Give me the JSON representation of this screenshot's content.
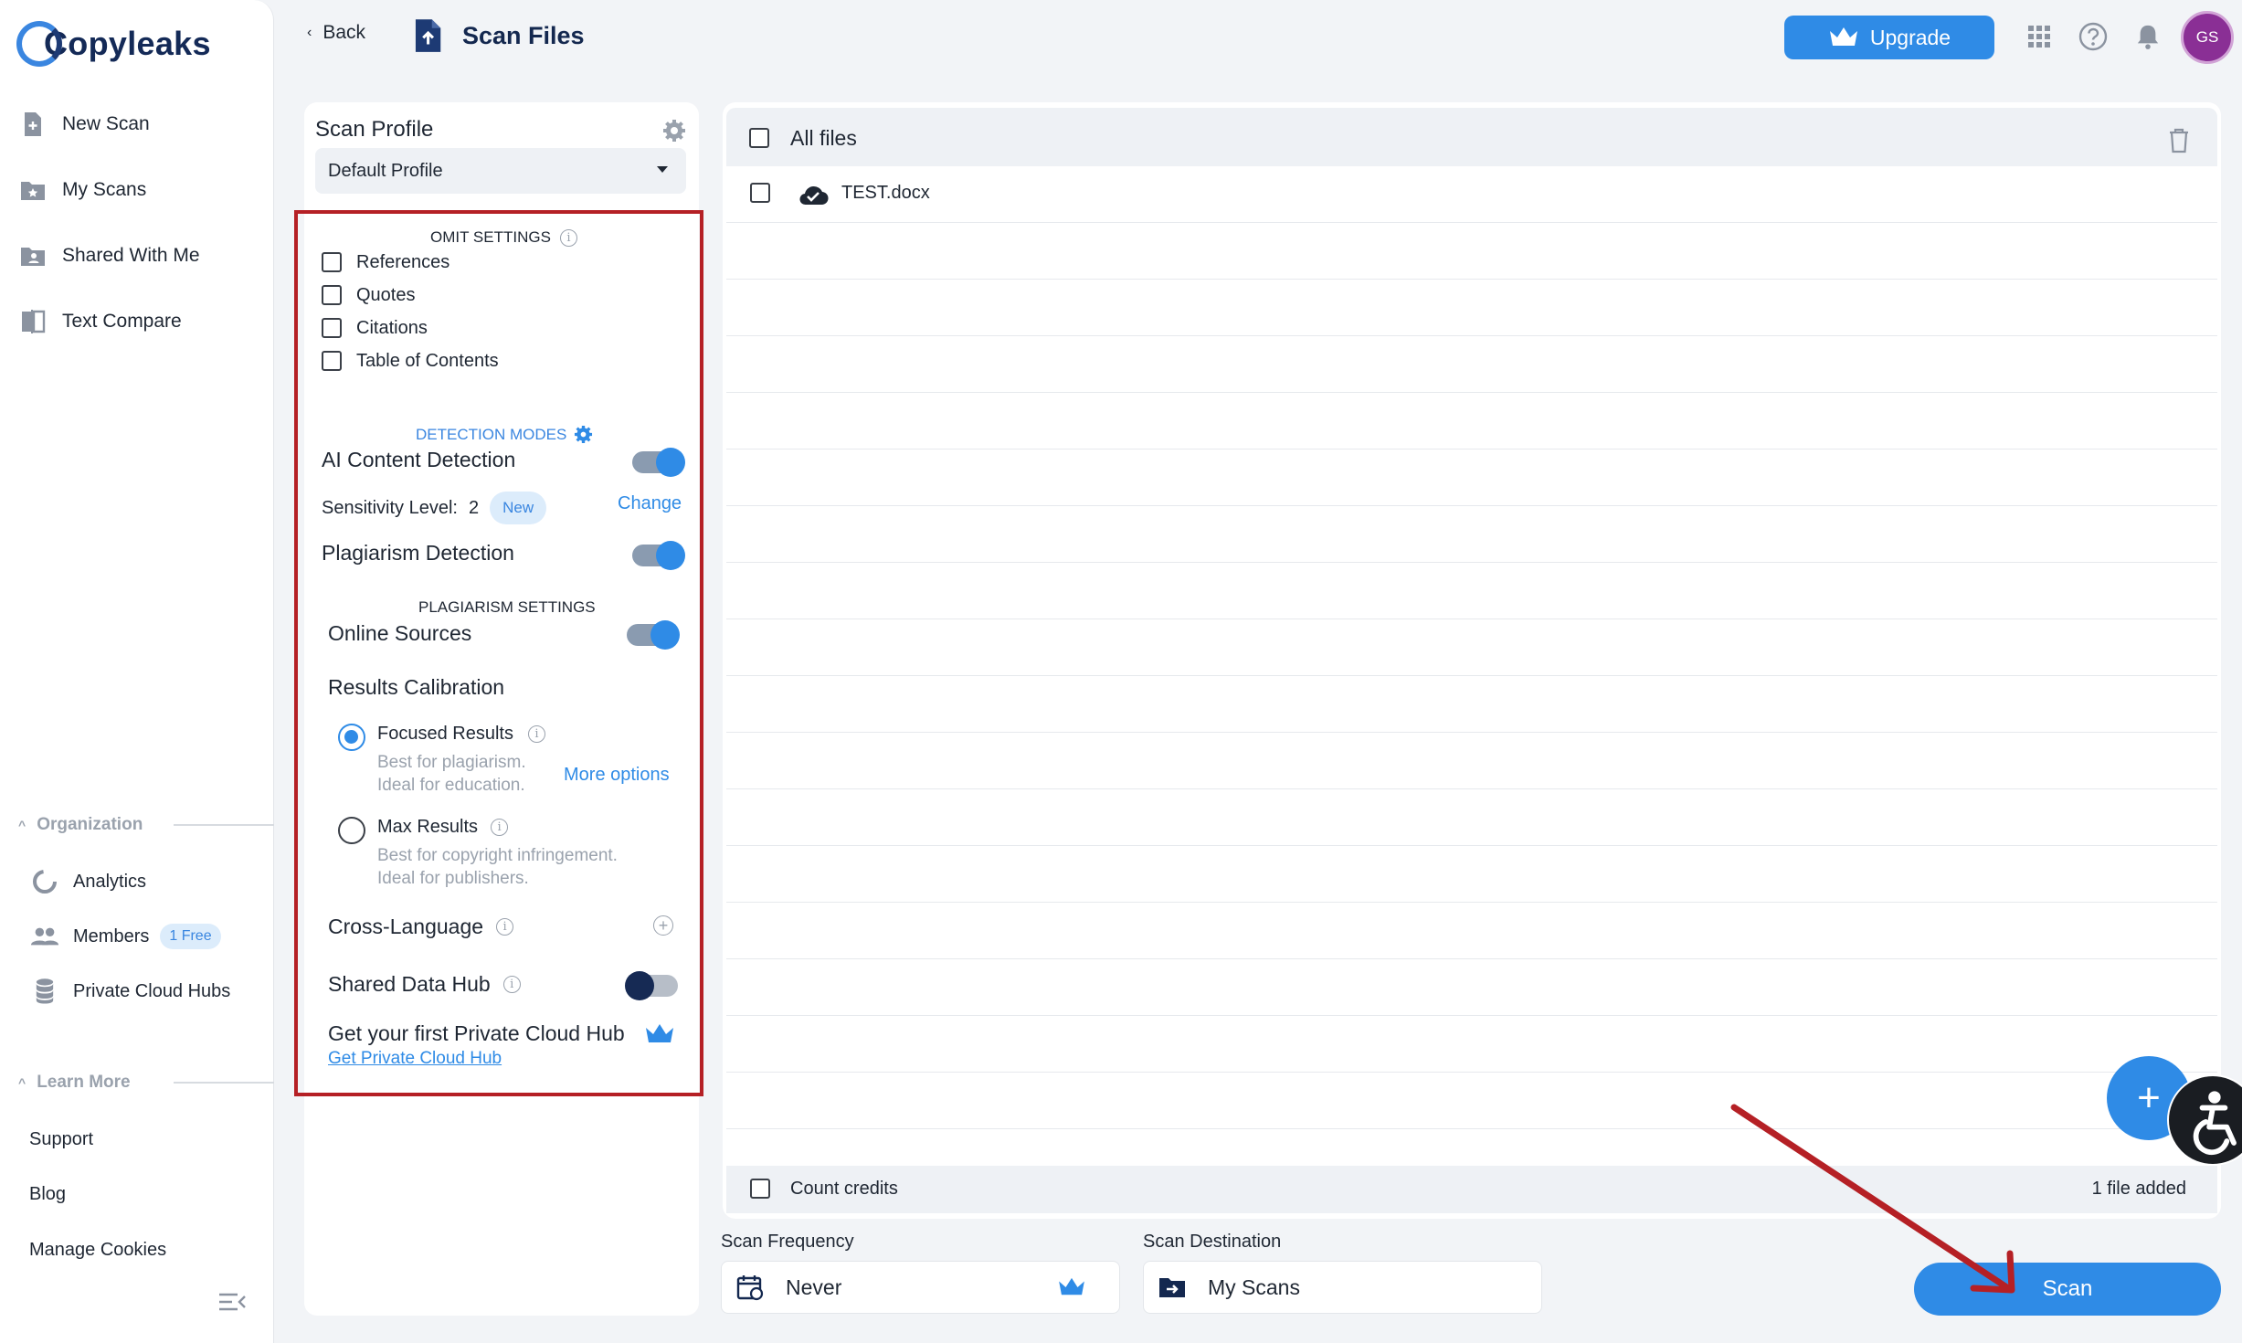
{
  "brand": {
    "name": "Copyleaks"
  },
  "sidebar": {
    "nav": [
      {
        "label": "New Scan",
        "icon": "new-scan-icon"
      },
      {
        "label": "My Scans",
        "icon": "my-scans-icon"
      },
      {
        "label": "Shared With Me",
        "icon": "shared-folder-icon"
      },
      {
        "label": "Text Compare",
        "icon": "text-compare-icon"
      }
    ],
    "organization": {
      "title": "Organization",
      "items": [
        {
          "label": "Analytics",
          "icon": "analytics-icon"
        },
        {
          "label": "Members",
          "icon": "members-icon",
          "badge": "1 Free"
        },
        {
          "label": "Private Cloud Hubs",
          "icon": "database-icon"
        }
      ]
    },
    "learn_more": {
      "title": "Learn More",
      "items": [
        {
          "label": "Support"
        },
        {
          "label": "Blog"
        },
        {
          "label": "Manage Cookies"
        }
      ]
    }
  },
  "header": {
    "back_label": "Back",
    "title": "Scan Files",
    "upgrade_label": "Upgrade",
    "avatar_initials": "GS"
  },
  "profile": {
    "title": "Scan Profile",
    "selected": "Default Profile",
    "omit_settings": {
      "title": "OMIT SETTINGS",
      "options": [
        "References",
        "Quotes",
        "Citations",
        "Table of Contents"
      ]
    },
    "detection_modes": {
      "title": "DETECTION MODES",
      "ai_label": "AI Content Detection",
      "ai_enabled": true,
      "sensitivity_label": "Sensitivity Level:",
      "sensitivity_value": "2",
      "new_badge": "New",
      "change_label": "Change",
      "plagiarism_label": "Plagiarism Detection",
      "plagiarism_enabled": true
    },
    "plagiarism_settings": {
      "title": "PLAGIARISM SETTINGS",
      "online_sources_label": "Online Sources",
      "online_sources_enabled": true,
      "calibration_label": "Results Calibration",
      "focused_title": "Focused Results",
      "focused_desc_1": "Best for plagiarism.",
      "focused_desc_2": "Ideal for education.",
      "more_options": "More options",
      "max_title": "Max Results",
      "max_desc_1": "Best for copyright infringement.",
      "max_desc_2": "Ideal for publishers.",
      "cross_language": "Cross-Language",
      "shared_data_hub": "Shared Data Hub",
      "shared_data_hub_enabled": false,
      "private_hub_promo": "Get your first Private Cloud Hub",
      "private_hub_link": "Get Private Cloud Hub"
    }
  },
  "files": {
    "header_label": "All files",
    "items": [
      {
        "name": "TEST.docx",
        "status": "uploaded"
      }
    ],
    "count_credits_label": "Count credits",
    "files_added": "1 file added"
  },
  "bottom": {
    "frequency_label": "Scan Frequency",
    "frequency_value": "Never",
    "destination_label": "Scan Destination",
    "destination_value": "My Scans",
    "scan_button": "Scan"
  },
  "colors": {
    "accent": "#2f8be6",
    "navy": "#14284f",
    "highlight_box": "#b52025",
    "avatar": "#8a2f95"
  }
}
